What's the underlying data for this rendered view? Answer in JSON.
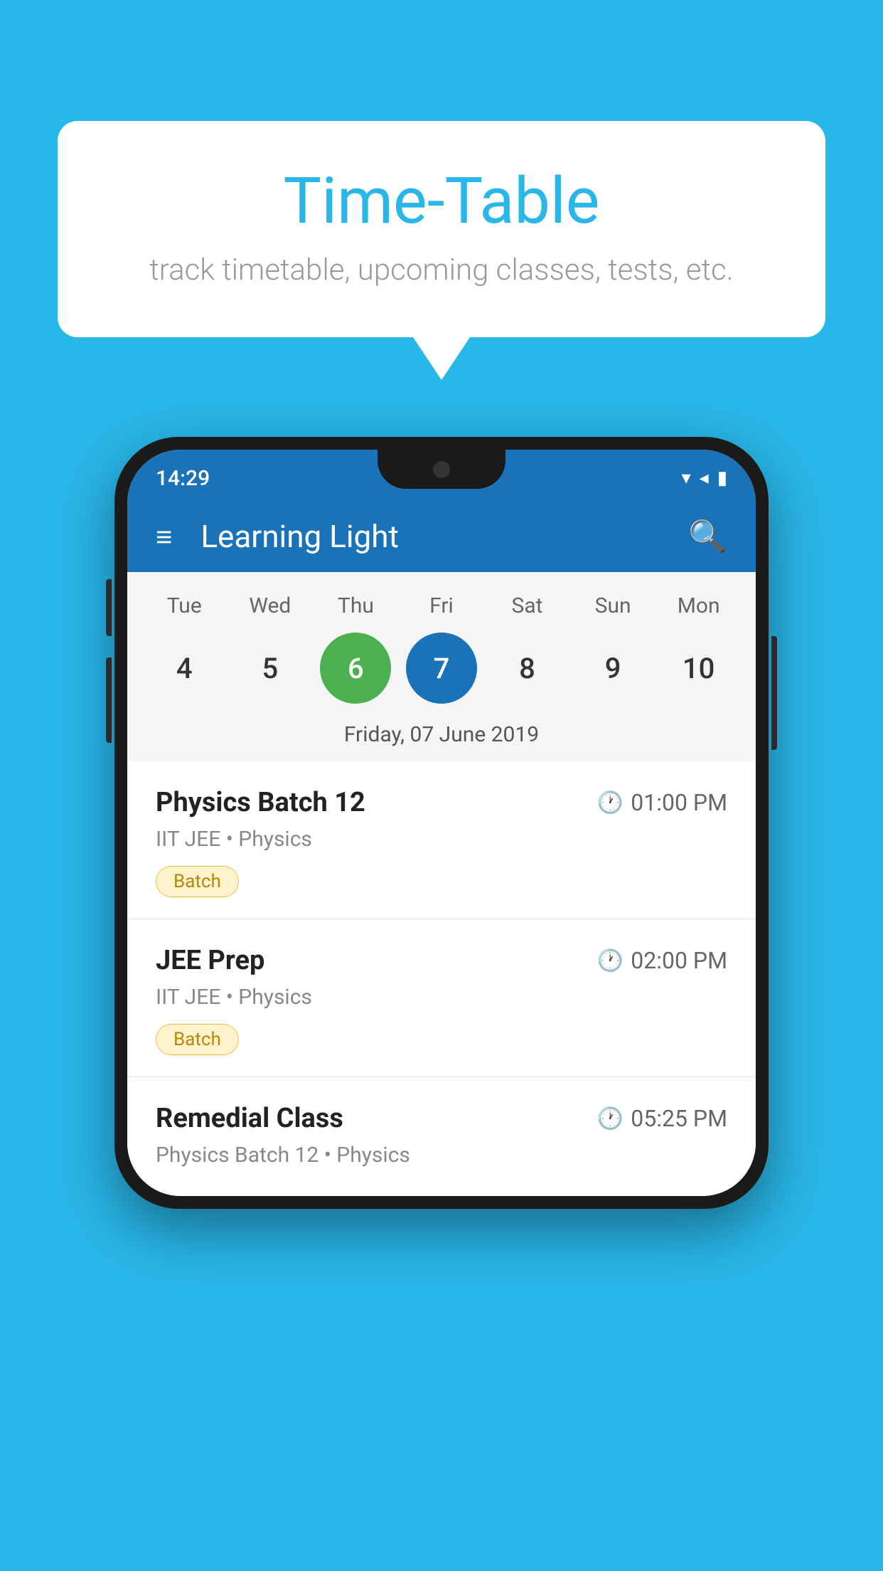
{
  "background_color": "#29B6E8",
  "speech_bubble": {
    "title": "Time-Table",
    "subtitle": "track timetable, upcoming classes, tests, etc."
  },
  "phone": {
    "status_bar": {
      "time": "14:29",
      "icons": [
        "wifi",
        "signal",
        "battery"
      ]
    },
    "app_header": {
      "title": "Learning Light"
    },
    "calendar": {
      "days": [
        "Tue",
        "Wed",
        "Thu",
        "Fri",
        "Sat",
        "Sun",
        "Mon"
      ],
      "dates": [
        {
          "num": "4",
          "state": "normal"
        },
        {
          "num": "5",
          "state": "normal"
        },
        {
          "num": "6",
          "state": "today"
        },
        {
          "num": "7",
          "state": "selected"
        },
        {
          "num": "8",
          "state": "normal"
        },
        {
          "num": "9",
          "state": "normal"
        },
        {
          "num": "10",
          "state": "normal"
        }
      ],
      "selected_date_label": "Friday, 07 June 2019"
    },
    "schedule": [
      {
        "title": "Physics Batch 12",
        "time": "01:00 PM",
        "subtitle": "IIT JEE • Physics",
        "tag": "Batch"
      },
      {
        "title": "JEE Prep",
        "time": "02:00 PM",
        "subtitle": "IIT JEE • Physics",
        "tag": "Batch"
      },
      {
        "title": "Remedial Class",
        "time": "05:25 PM",
        "subtitle": "Physics Batch 12 • Physics",
        "tag": null
      }
    ]
  }
}
